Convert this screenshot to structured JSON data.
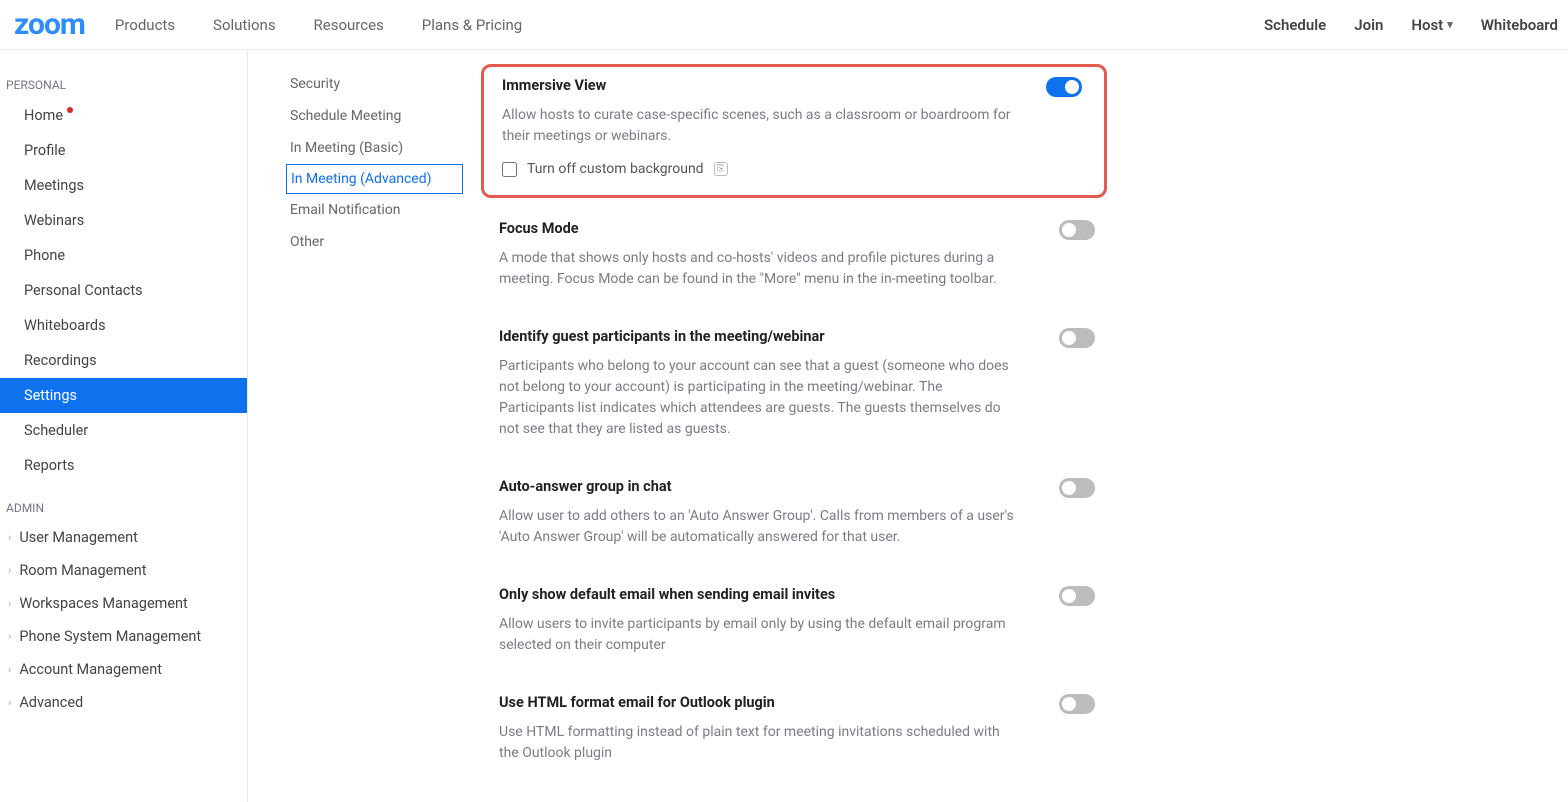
{
  "topbar": {
    "logo": "zoom",
    "left": [
      "Products",
      "Solutions",
      "Resources",
      "Plans & Pricing"
    ],
    "right": [
      "Schedule",
      "Join",
      "Host",
      "Whiteboard"
    ]
  },
  "sidebar": {
    "personal_label": "PERSONAL",
    "personal": [
      {
        "label": "Home",
        "dot": true
      },
      {
        "label": "Profile"
      },
      {
        "label": "Meetings"
      },
      {
        "label": "Webinars"
      },
      {
        "label": "Phone"
      },
      {
        "label": "Personal Contacts"
      },
      {
        "label": "Whiteboards"
      },
      {
        "label": "Recordings"
      },
      {
        "label": "Settings",
        "active": true
      },
      {
        "label": "Scheduler"
      },
      {
        "label": "Reports"
      }
    ],
    "admin_label": "ADMIN",
    "admin": [
      "User Management",
      "Room Management",
      "Workspaces Management",
      "Phone System Management",
      "Account Management",
      "Advanced"
    ]
  },
  "subnav": [
    {
      "label": "Security"
    },
    {
      "label": "Schedule Meeting"
    },
    {
      "label": "In Meeting (Basic)"
    },
    {
      "label": "In Meeting (Advanced)",
      "selected": true
    },
    {
      "label": "Email Notification"
    },
    {
      "label": "Other"
    }
  ],
  "settings": [
    {
      "title": "Immersive View",
      "desc": "Allow hosts to curate case-specific scenes, such as a classroom or boardroom for their meetings or webinars.",
      "toggle": true,
      "highlight": true,
      "checkbox": "Turn off custom background"
    },
    {
      "title": "Focus Mode",
      "desc": "A mode that shows only hosts and co-hosts' videos and profile pictures during a meeting. Focus Mode can be found in the \"More\" menu in the in-meeting toolbar.",
      "toggle": false
    },
    {
      "title": "Identify guest participants in the meeting/webinar",
      "desc": "Participants who belong to your account can see that a guest (someone who does not belong to your account) is participating in the meeting/webinar. The Participants list indicates which attendees are guests. The guests themselves do not see that they are listed as guests.",
      "toggle": false
    },
    {
      "title": "Auto-answer group in chat",
      "desc": "Allow user to add others to an 'Auto Answer Group'. Calls from members of a user's 'Auto Answer Group' will be automatically answered for that user.",
      "toggle": false
    },
    {
      "title": "Only show default email when sending email invites",
      "desc": "Allow users to invite participants by email only by using the default email program selected on their computer",
      "toggle": false
    },
    {
      "title": "Use HTML format email for Outlook plugin",
      "desc": "Use HTML formatting instead of plain text for meeting invitations scheduled with the Outlook plugin",
      "toggle": false
    }
  ]
}
